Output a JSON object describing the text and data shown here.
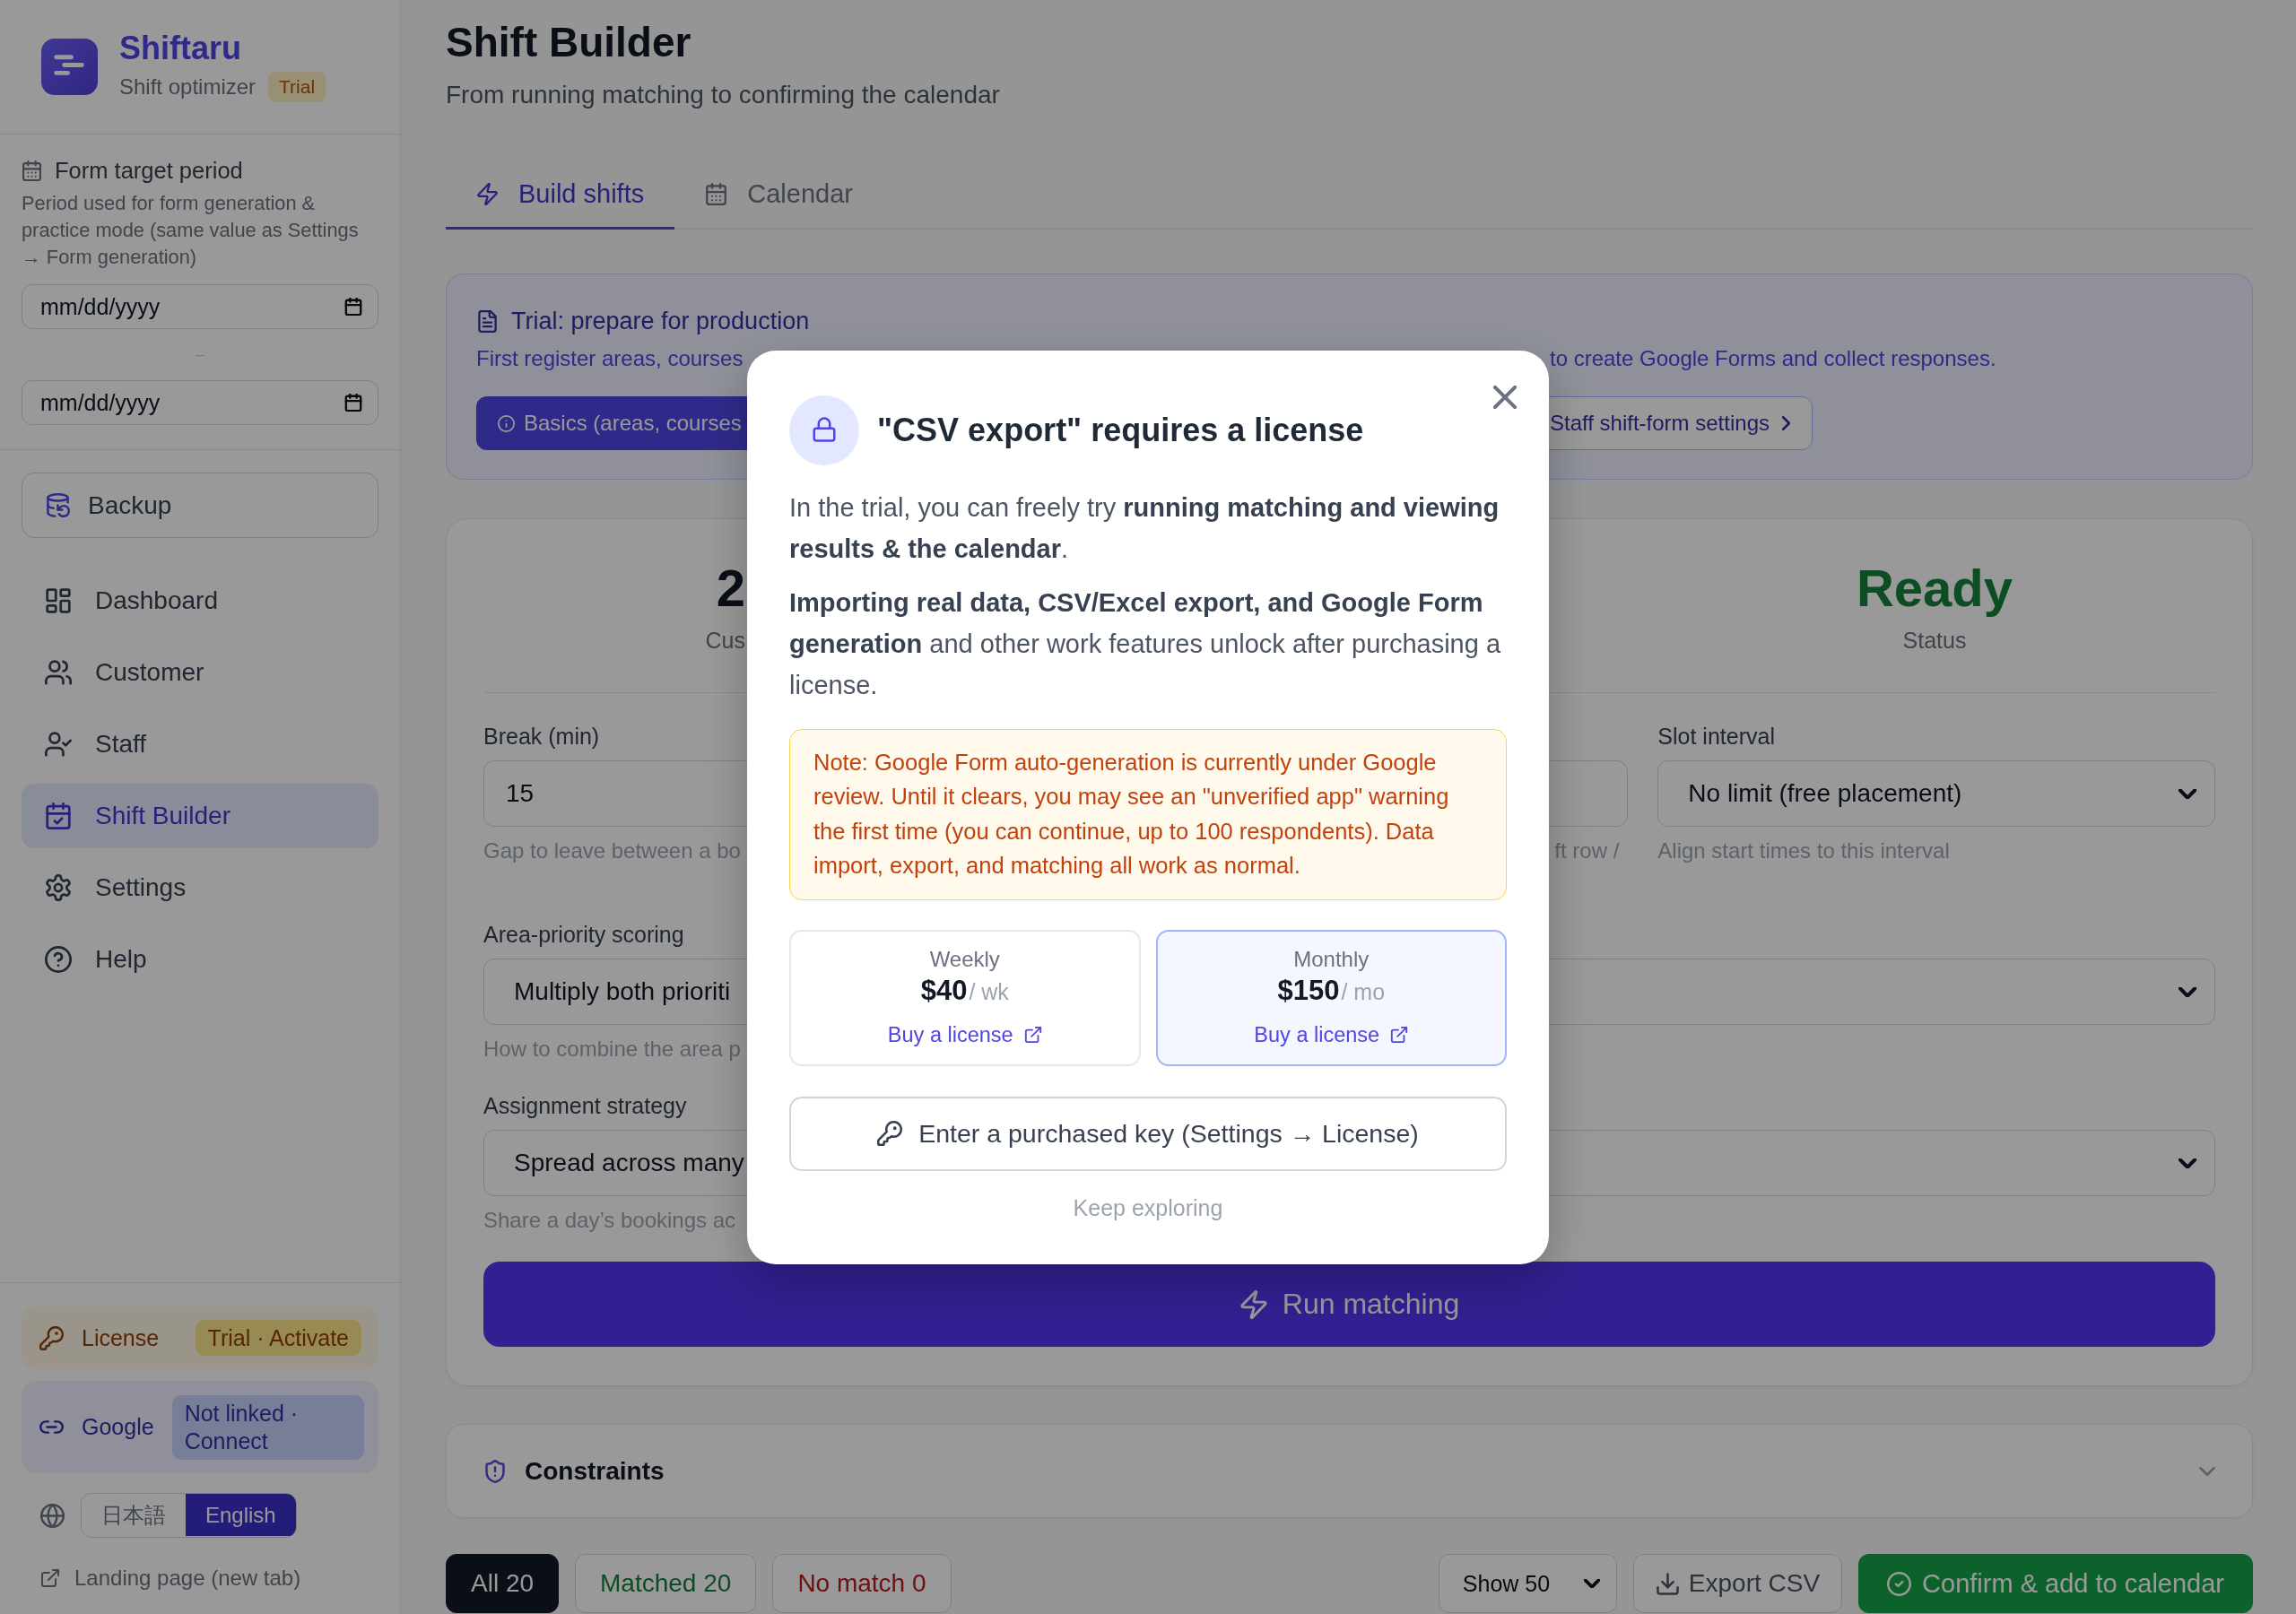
{
  "sidebar": {
    "brand": {
      "name": "Shiftaru",
      "tagline": "Shift optimizer",
      "badge": "Trial"
    },
    "period": {
      "label": "Form target period",
      "description": "Period used for form generation & practice mode (same value as Settings → Form generation)",
      "start": {
        "placeholder": "mm/dd/yyyy"
      },
      "separator": "–",
      "end": {
        "placeholder": "mm/dd/yyyy"
      }
    },
    "backup_button": "Backup",
    "nav": [
      {
        "label": "Dashboard",
        "selected": false
      },
      {
        "label": "Customer",
        "selected": false
      },
      {
        "label": "Staff",
        "selected": false
      },
      {
        "label": "Shift Builder",
        "selected": true
      },
      {
        "label": "Settings",
        "selected": false
      },
      {
        "label": "Help",
        "selected": false
      }
    ],
    "license": {
      "label": "License",
      "badge": "Trial · Activate"
    },
    "google": {
      "label": "Google",
      "badge": "Not linked · Connect"
    },
    "languages": [
      {
        "label": "日本語",
        "selected": false
      },
      {
        "label": "English",
        "selected": true
      }
    ],
    "landing_link": "Landing page (new tab)"
  },
  "header": {
    "title": "Shift Builder",
    "subtitle": "From running matching to confirming the calendar"
  },
  "tabs": [
    {
      "label": "Build shifts",
      "selected": true
    },
    {
      "label": "Calendar",
      "selected": false
    }
  ],
  "banner": {
    "title": "Trial: prepare for production",
    "description": [
      "First register areas, courses",
      "to create Google Forms and collect responses."
    ],
    "buttons": [
      {
        "label": "Basics (areas, courses",
        "kind": "primary"
      },
      {
        "label": "Staff shift-form settings",
        "kind": "outline"
      }
    ]
  },
  "card": {
    "stats": [
      {
        "value": "2",
        "label": "Cus",
        "kind": "count"
      },
      {
        "value": "Ready",
        "label": "Status",
        "kind": "status"
      }
    ],
    "rows": [
      {
        "fields": [
          {
            "kind": "input",
            "label": "Break (min)",
            "value": "15",
            "help": "Gap to leave between a bo"
          },
          {
            "kind": "input",
            "help": "ft row /"
          },
          {
            "kind": "select",
            "label": "Slot interval",
            "value": "No limit (free placement)",
            "help": "Align start times to this interval"
          }
        ]
      },
      {
        "fields": [
          {
            "kind": "select",
            "label": "Area-priority scoring",
            "value": "Multiply both prioriti",
            "help": "How to combine the area p"
          },
          {
            "kind": "select"
          }
        ]
      },
      {
        "fields": [
          {
            "kind": "select",
            "label": "Assignment strategy",
            "value": "Spread across many",
            "help": "Share a day’s bookings ac"
          },
          {
            "kind": "select"
          }
        ]
      }
    ],
    "run_button": "Run matching"
  },
  "constraints": {
    "title": "Constraints",
    "expanded": false
  },
  "bottom_bar": {
    "filters": [
      {
        "label": "All 20",
        "kind": "all",
        "selected": true
      },
      {
        "label": "Matched 20",
        "kind": "matched",
        "selected": false
      },
      {
        "label": "No match 0",
        "kind": "unmatched",
        "selected": false
      }
    ],
    "page_size": "Show 50",
    "export_button": "Export CSV",
    "confirm_button": "Confirm & add to calendar"
  },
  "modal": {
    "title": "\"CSV export\" requires a license",
    "paragraphs": [
      "In the trial, you can freely try **running matching and viewing results & the calendar**.",
      "**Importing real data, CSV/Excel export, and Google Form generation** and other work features unlock after purchasing a license."
    ],
    "note": "Note: Google Form auto-generation is currently under Google review. Until it clears, you may see an \"unverified app\" warning the first time (you can continue, up to 100 respondents). Data import, export, and matching all work as normal.",
    "plans": [
      {
        "name": "Weekly",
        "price": "$40",
        "unit": "/ wk",
        "link": "Buy a license",
        "selected": false
      },
      {
        "name": "Monthly",
        "price": "$150",
        "unit": "/ mo",
        "link": "Buy a license",
        "selected": true
      }
    ],
    "key_button": "Enter a purchased key (Settings → License)",
    "dismiss_link": "Keep exploring"
  }
}
